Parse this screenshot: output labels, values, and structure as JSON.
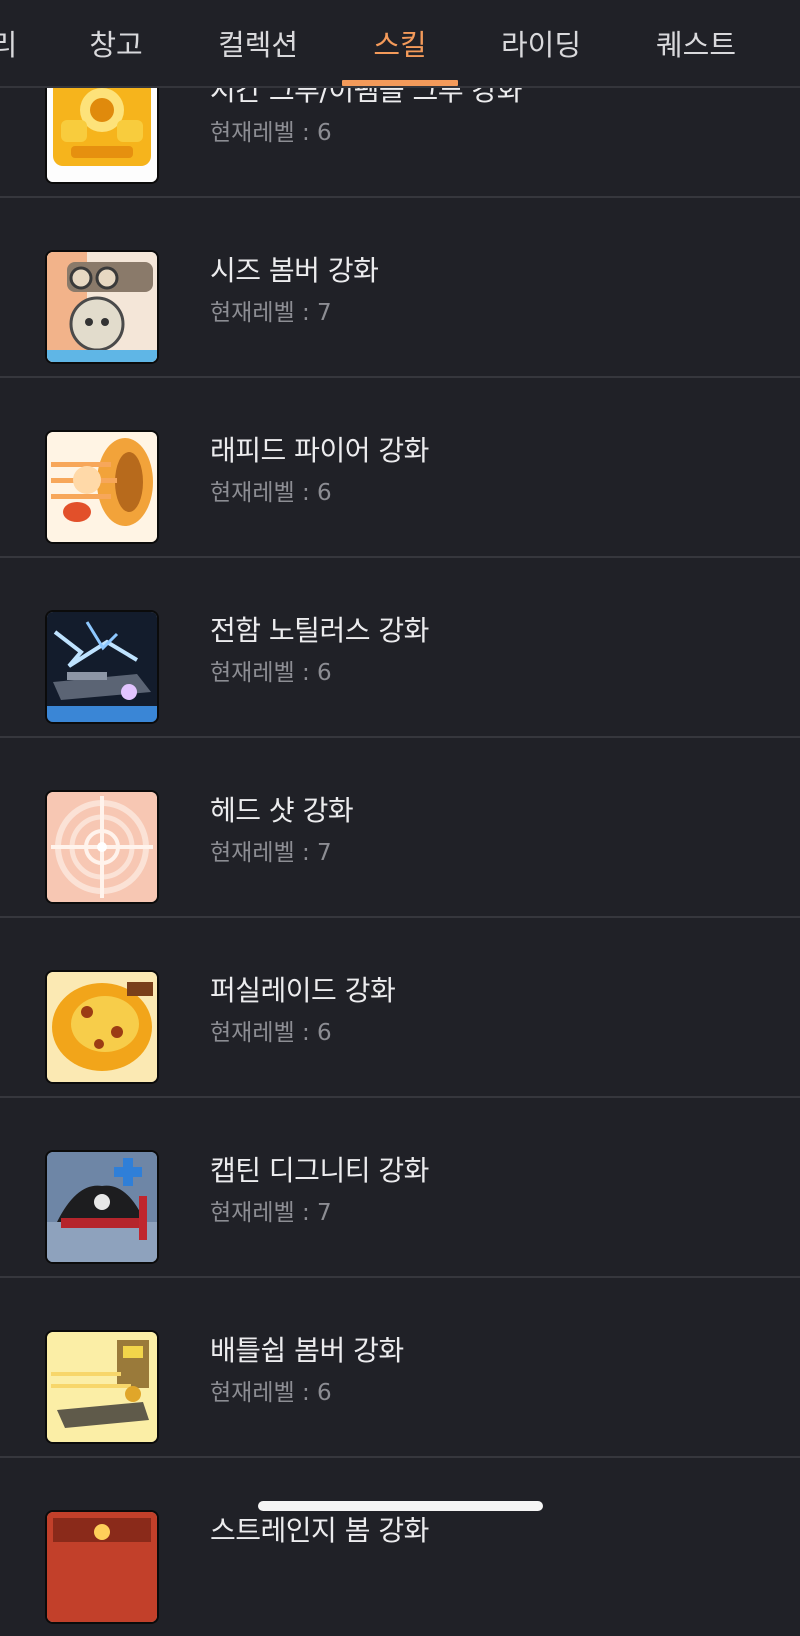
{
  "tabs": [
    {
      "label": "리",
      "active": false
    },
    {
      "label": "창고",
      "active": false
    },
    {
      "label": "컬렉션",
      "active": false
    },
    {
      "label": "스킬",
      "active": true
    },
    {
      "label": "라이딩",
      "active": false
    },
    {
      "label": "퀘스트",
      "active": false
    }
  ],
  "accent_color": "#f39a5a",
  "skills": [
    {
      "name": "시간 그루/이펨블 그루 강화",
      "level": "현재레벨 : 6",
      "icon": "golden-crest-icon"
    },
    {
      "name": "시즈 봄버 강화",
      "level": "현재레벨 : 7",
      "icon": "siege-bomber-icon"
    },
    {
      "name": "래피드 파이어 강화",
      "level": "현재레벨 : 6",
      "icon": "rapid-fire-icon"
    },
    {
      "name": "전함 노틸러스 강화",
      "level": "현재레벨 : 6",
      "icon": "battleship-nautilus-icon"
    },
    {
      "name": "헤드 샷 강화",
      "level": "현재레벨 : 7",
      "icon": "headshot-crosshair-icon"
    },
    {
      "name": "퍼실레이드 강화",
      "level": "현재레벨 : 6",
      "icon": "fusillade-icon"
    },
    {
      "name": "캡틴 디그니티 강화",
      "level": "현재레벨 : 7",
      "icon": "captain-hat-icon"
    },
    {
      "name": "배틀쉽 봄버 강화",
      "level": "현재레벨 : 6",
      "icon": "battleship-bomber-icon"
    },
    {
      "name": "스트레인지 봄 강화",
      "level": "",
      "icon": "strange-bomb-icon"
    }
  ]
}
